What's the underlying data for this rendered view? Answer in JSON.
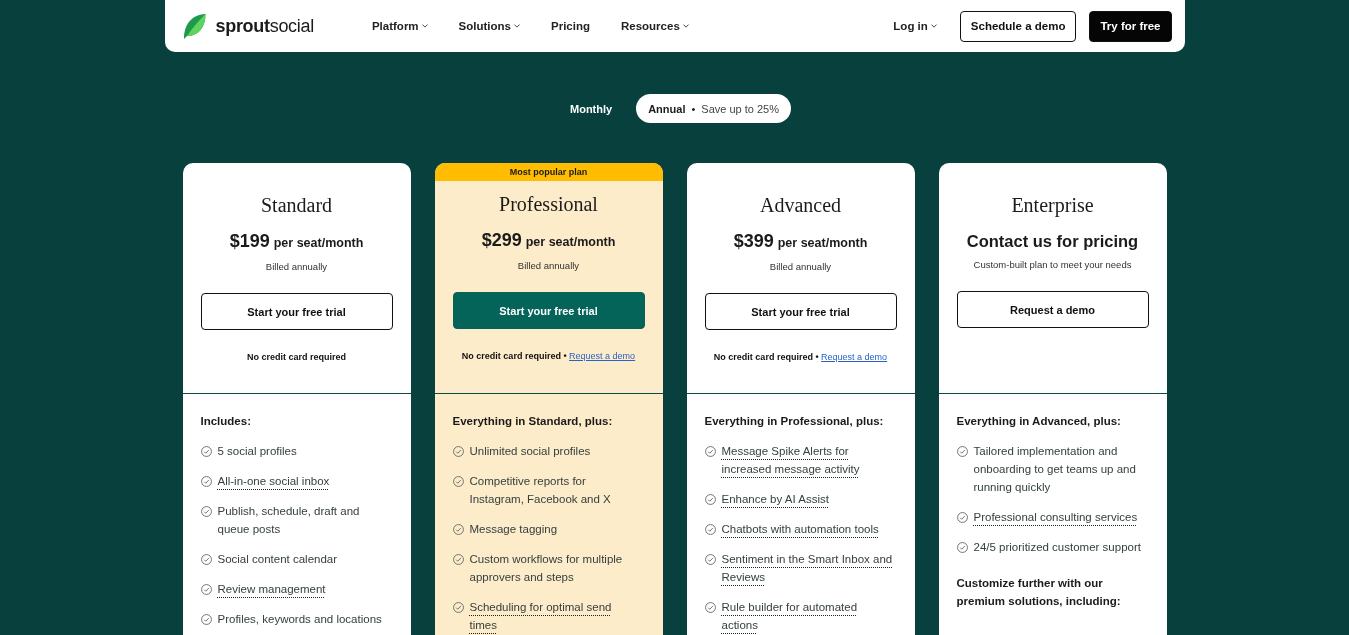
{
  "header": {
    "brand": "**sprout**social",
    "nav": [
      {
        "label": "Platform",
        "dropdown": true
      },
      {
        "label": "Solutions",
        "dropdown": true
      },
      {
        "label": "Pricing",
        "dropdown": false
      },
      {
        "label": "Resources",
        "dropdown": true
      }
    ],
    "login": {
      "label": "Log in",
      "dropdown": true
    },
    "buttons": [
      {
        "label": "Schedule a demo",
        "kind": "outline"
      },
      {
        "label": "Try for free",
        "kind": "solid"
      }
    ]
  },
  "billing_toggle": {
    "options": [
      {
        "label": "Monthly",
        "selected": false
      },
      {
        "label": "Annual",
        "separator": "•",
        "note": "Save up to 25%",
        "selected": true
      }
    ]
  },
  "plans": [
    {
      "name": "Standard",
      "featured": false,
      "price": "$199",
      "period": "per seat/month",
      "subtext": "Billed annually",
      "button": "Start your free trial",
      "note": "No credit card required",
      "features_heading": "Includes:",
      "features": [
        {
          "text": "5 social profiles",
          "underlined": false
        },
        {
          "text": "All-in-one social inbox",
          "underlined": true
        },
        {
          "text": "Publish, schedule, draft and queue posts",
          "underlined": false
        },
        {
          "text": "Social content calendar",
          "underlined": false
        },
        {
          "text": "Review management",
          "underlined": true
        },
        {
          "text": "Profiles, keywords and locations",
          "underlined": false
        }
      ]
    },
    {
      "name": "Professional",
      "featured": true,
      "badge": "Most popular plan",
      "price": "$299",
      "period": "per seat/month",
      "subtext": "Billed annually",
      "button": "Start your free trial",
      "note": "No credit card required",
      "separator": "•",
      "link": "Request a demo",
      "features_heading": "Everything in Standard, plus:",
      "features": [
        {
          "text": "Unlimited social profiles",
          "underlined": false
        },
        {
          "text": "Competitive reports for Instagram, Facebook and X",
          "underlined": false
        },
        {
          "text": "Message tagging",
          "underlined": false
        },
        {
          "text": "Custom workflows for multiple approvers and steps",
          "underlined": false
        },
        {
          "text": "Scheduling for optimal send times",
          "underlined": true
        }
      ]
    },
    {
      "name": "Advanced",
      "featured": false,
      "price": "$399",
      "period": "per seat/month",
      "subtext": "Billed annually",
      "button": "Start your free trial",
      "note": "No credit card required",
      "separator": "•",
      "link": "Request a demo",
      "features_heading": "Everything in Professional, plus:",
      "features": [
        {
          "text": "Message Spike Alerts for increased message activity",
          "underlined": true
        },
        {
          "text": "Enhance by AI Assist",
          "underlined": true
        },
        {
          "text": "Chatbots with automation tools",
          "underlined": true
        },
        {
          "text": "Sentiment in the Smart Inbox and Reviews",
          "underlined": true
        },
        {
          "text": "Rule builder for automated actions",
          "underlined": true
        }
      ]
    },
    {
      "name": "Enterprise",
      "featured": false,
      "price_heading": "Contact us for pricing",
      "subtext": "Custom-built plan to meet your needs",
      "button": "Request a demo",
      "features_heading": "Everything in Advanced, plus:",
      "features": [
        {
          "text": "Tailored implementation and onboarding to get teams up and running quickly",
          "underlined": false
        },
        {
          "text": "Professional consulting services",
          "underlined": true
        },
        {
          "text": "24/5 prioritized customer support",
          "underlined": false
        }
      ],
      "features_footer": "Customize further with our premium solutions, including:"
    }
  ]
}
